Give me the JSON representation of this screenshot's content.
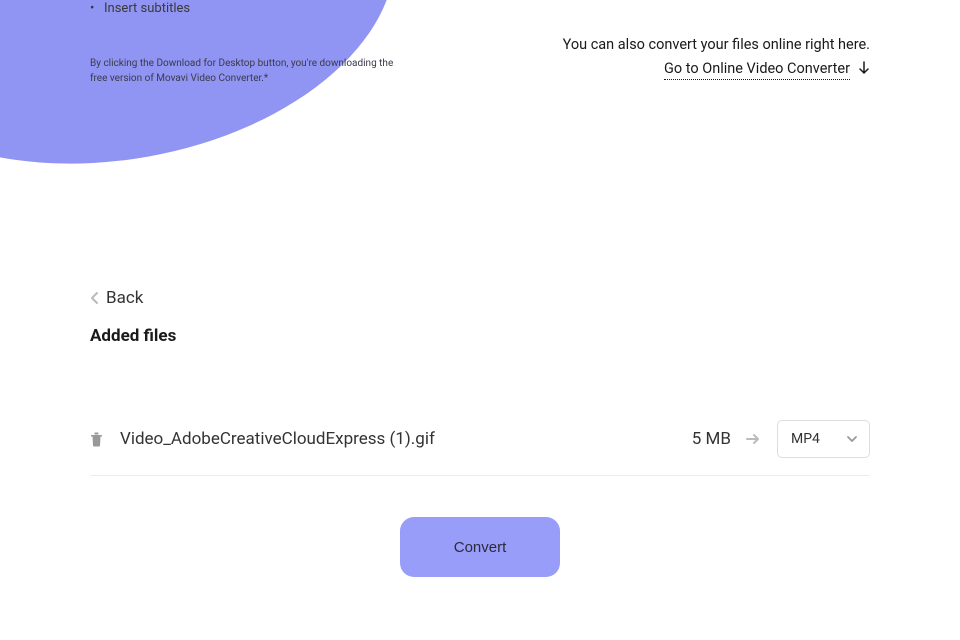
{
  "hero": {
    "bullet": "Insert subtitles",
    "disclaimer": "By clicking the Download for Desktop button, you're downloading the free version of Movavi Video Converter.*"
  },
  "rightInfo": {
    "line": "You can also convert your files online right here.",
    "link": "Go to Online Video Converter"
  },
  "files": {
    "backLabel": "Back",
    "title": "Added files",
    "items": [
      {
        "name": "Video_AdobeCreativeCloudExpress (1).gif",
        "size": "5 MB",
        "format": "MP4"
      }
    ]
  },
  "actions": {
    "convert": "Convert"
  }
}
